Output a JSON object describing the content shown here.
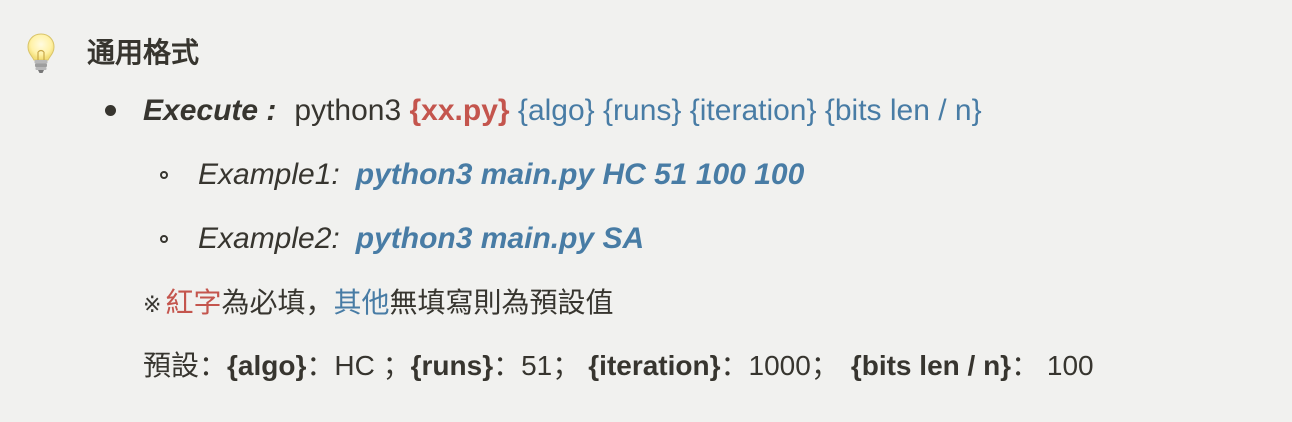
{
  "callout": {
    "icon": "lightbulb-icon",
    "title": "通用格式"
  },
  "execute": {
    "label": "Execute :",
    "command": "python3",
    "script_arg": "{xx.py}",
    "optional_args": "{algo} {runs} {iteration} {bits len / n}"
  },
  "examples": [
    {
      "label": "Example1:",
      "command": "python3 main.py HC 51 100 100"
    },
    {
      "label": "Example2:",
      "command": "python3 main.py SA"
    }
  ],
  "note": {
    "mark": "※",
    "red_text": "紅字",
    "text1": "為必填，",
    "blue_text": "其他",
    "text2": "無填寫則為預設值"
  },
  "defaults": {
    "prefix": "預設：",
    "items": [
      {
        "key": "{algo}",
        "sep": "：",
        "value": "HC ；"
      },
      {
        "key": "{runs}",
        "sep": "：",
        "value": "51；"
      },
      {
        "key": "{iteration}",
        "sep": "：",
        "value": "1000；"
      },
      {
        "key": "{bits len / n}",
        "sep": "：",
        "value": " 100"
      }
    ]
  },
  "colors": {
    "required_red": "#c4554d",
    "optional_blue": "#487ca5",
    "text": "#37352f",
    "background": "#f1f1ef"
  }
}
